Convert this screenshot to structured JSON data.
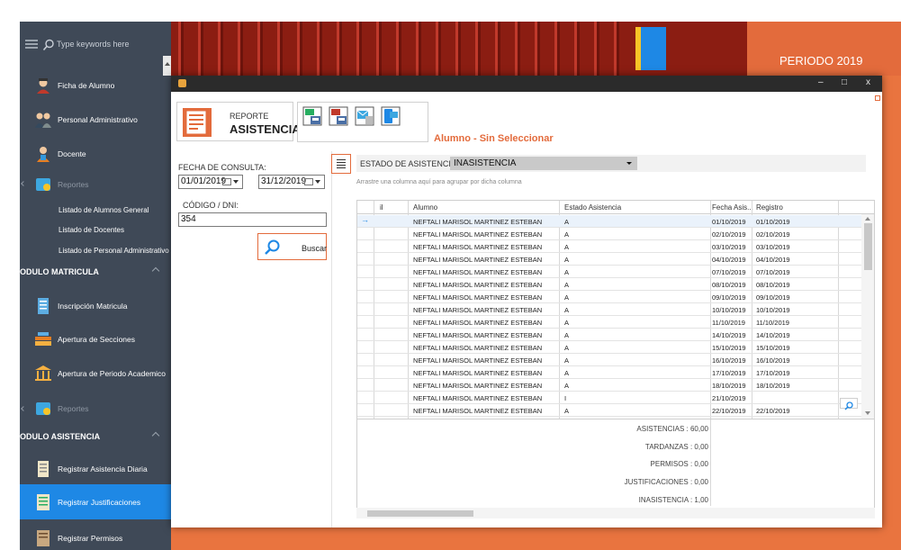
{
  "sidebar": {
    "search_placeholder": "Type keywords here",
    "items": [
      {
        "label": "Ficha de Alumno"
      },
      {
        "label": "Personal Administrativo"
      },
      {
        "label": "Docente"
      },
      {
        "label": "Reportes"
      }
    ],
    "reportes_sub": [
      "Listado de Alumnos General",
      "Listado de Docentes",
      "Listado de Personal Administrativo"
    ],
    "section_matricula": "ODULO MATRICULA",
    "matricula_items": [
      {
        "label": "Inscripción Matricula"
      },
      {
        "label": "Apertura de Secciones"
      },
      {
        "label": "Apertura de Periodo Academico"
      },
      {
        "label": "Reportes"
      }
    ],
    "section_asistencia": "ODULO ASISTENCIA",
    "asistencia_items": [
      {
        "label": "Registrar Asistencia Diaria"
      },
      {
        "label": "Registrar Justificaciones"
      },
      {
        "label": "Registrar Permisos"
      }
    ]
  },
  "banner": {
    "periodo": "PERIODO 2019"
  },
  "window": {
    "controls": {
      "minimize": "–",
      "maximize": "□",
      "close": "x"
    },
    "header": {
      "reporte": "REPORTE",
      "asistencia": "ASISTENCIA",
      "alumno_status": "Alumno - Sin Seleccionar"
    },
    "filters": {
      "fecha_label": "FECHA DE CONSULTA:",
      "fecha_desde": "01/01/2019",
      "fecha_hasta": "31/12/2019",
      "codigo_label": "CÓDIGO / DNI:",
      "codigo_value": "354",
      "buscar": "Buscar"
    },
    "estado_label": "ESTADO DE ASISTENCIA:",
    "estado_value": "INASISTENCIA",
    "group_hint": "Arrastre una columna aquí para agrupar por dicha columna",
    "columns": [
      "il",
      "Alumno",
      "Estado Asistencia",
      "Fecha Asis...",
      "Registro"
    ],
    "rows": [
      [
        "NEFTALI MARISOL MARTINEZ ESTEBAN",
        "A",
        "01/10/2019",
        "01/10/2019"
      ],
      [
        "NEFTALI MARISOL MARTINEZ ESTEBAN",
        "A",
        "02/10/2019",
        "02/10/2019"
      ],
      [
        "NEFTALI MARISOL MARTINEZ ESTEBAN",
        "A",
        "03/10/2019",
        "03/10/2019"
      ],
      [
        "NEFTALI MARISOL MARTINEZ ESTEBAN",
        "A",
        "04/10/2019",
        "04/10/2019"
      ],
      [
        "NEFTALI MARISOL MARTINEZ ESTEBAN",
        "A",
        "07/10/2019",
        "07/10/2019"
      ],
      [
        "NEFTALI MARISOL MARTINEZ ESTEBAN",
        "A",
        "08/10/2019",
        "08/10/2019"
      ],
      [
        "NEFTALI MARISOL MARTINEZ ESTEBAN",
        "A",
        "09/10/2019",
        "09/10/2019"
      ],
      [
        "NEFTALI MARISOL MARTINEZ ESTEBAN",
        "A",
        "10/10/2019",
        "10/10/2019"
      ],
      [
        "NEFTALI MARISOL MARTINEZ ESTEBAN",
        "A",
        "11/10/2019",
        "11/10/2019"
      ],
      [
        "NEFTALI MARISOL MARTINEZ ESTEBAN",
        "A",
        "14/10/2019",
        "14/10/2019"
      ],
      [
        "NEFTALI MARISOL MARTINEZ ESTEBAN",
        "A",
        "15/10/2019",
        "15/10/2019"
      ],
      [
        "NEFTALI MARISOL MARTINEZ ESTEBAN",
        "A",
        "16/10/2019",
        "16/10/2019"
      ],
      [
        "NEFTALI MARISOL MARTINEZ ESTEBAN",
        "A",
        "17/10/2019",
        "17/10/2019"
      ],
      [
        "NEFTALI MARISOL MARTINEZ ESTEBAN",
        "A",
        "18/10/2019",
        "18/10/2019"
      ],
      [
        "NEFTALI MARISOL MARTINEZ ESTEBAN",
        "I",
        "21/10/2019",
        ""
      ],
      [
        "NEFTALI MARISOL MARTINEZ ESTEBAN",
        "A",
        "22/10/2019",
        "22/10/2019"
      ]
    ],
    "summary": {
      "asistencias": "ASISTENCIAS : 60,00",
      "tardanzas": "TARDANZAS : 0,00",
      "permisos": "PERMISOS : 0,00",
      "justificaciones": "JUSTIFICACIONES : 0,00",
      "inasistencia": "INASISTENCIA : 1,00"
    }
  },
  "colors": {
    "sidebar_bg": "#3f4957",
    "accent_orange": "#e36b3c",
    "active_blue": "#1e88e5",
    "titlebar": "#2b2b2b"
  }
}
